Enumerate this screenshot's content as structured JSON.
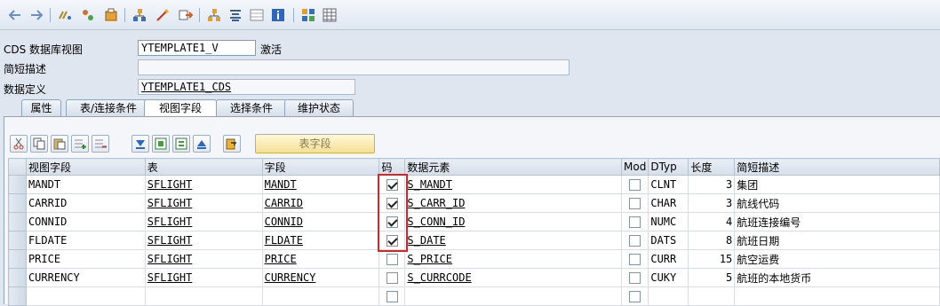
{
  "toolbar": {
    "icons": [
      "back-arrow-icon",
      "forward-arrow-icon",
      "other-object-icon",
      "display-change-icon",
      "activate-icon",
      "check-icon",
      "where-used-icon",
      "object-list-icon",
      "navigation-icon",
      "hierarchy-icon",
      "indent-icon",
      "info-icon",
      "layout-icon",
      "table-view-icon"
    ]
  },
  "form": {
    "view_label": "CDS 数据库视图",
    "view_value": "YTEMPLATE1_V",
    "status": "激活",
    "short_desc_label": "简短描述",
    "short_desc_value": "",
    "data_def_label": "数据定义",
    "data_def_value": "YTEMPLATE1_CDS"
  },
  "tabs": [
    {
      "label": "属性"
    },
    {
      "label": "表/连接条件"
    },
    {
      "label": "视图字段",
      "active": true
    },
    {
      "label": "选择条件"
    },
    {
      "label": "维护状态"
    }
  ],
  "table_toolbar": {
    "table_fields_button": "表字段"
  },
  "grid": {
    "headers": [
      "视图字段",
      "表",
      "字段",
      "码",
      "数据元素",
      "Mod",
      "DTyp",
      "长度",
      "简短描述"
    ],
    "rows": [
      {
        "view_field": "MANDT",
        "table": "SFLIGHT",
        "field": "MANDT",
        "key": true,
        "data_element": "S_MANDT",
        "mod": false,
        "dtyp": "CLNT",
        "length": "3",
        "desc": "集团"
      },
      {
        "view_field": "CARRID",
        "table": "SFLIGHT",
        "field": "CARRID",
        "key": true,
        "data_element": "S_CARR_ID",
        "mod": false,
        "dtyp": "CHAR",
        "length": "3",
        "desc": "航线代码"
      },
      {
        "view_field": "CONNID",
        "table": "SFLIGHT",
        "field": "CONNID",
        "key": true,
        "data_element": "S_CONN_ID",
        "mod": false,
        "dtyp": "NUMC",
        "length": "4",
        "desc": "航班连接编号"
      },
      {
        "view_field": "FLDATE",
        "table": "SFLIGHT",
        "field": "FLDATE",
        "key": true,
        "data_element": "S_DATE",
        "mod": false,
        "dtyp": "DATS",
        "length": "8",
        "desc": "航班日期"
      },
      {
        "view_field": "PRICE",
        "table": "SFLIGHT",
        "field": "PRICE",
        "key": false,
        "data_element": "S_PRICE",
        "mod": false,
        "dtyp": "CURR",
        "length": "15",
        "desc": "航空运费"
      },
      {
        "view_field": "CURRENCY",
        "table": "SFLIGHT",
        "field": "CURRENCY",
        "key": false,
        "data_element": "S_CURRCODE",
        "mod": false,
        "dtyp": "CUKY",
        "length": "5",
        "desc": "航班的本地货币"
      },
      {
        "view_field": "",
        "table": "",
        "field": "",
        "key": false,
        "data_element": "",
        "mod": false,
        "dtyp": "",
        "length": "",
        "desc": ""
      }
    ]
  }
}
